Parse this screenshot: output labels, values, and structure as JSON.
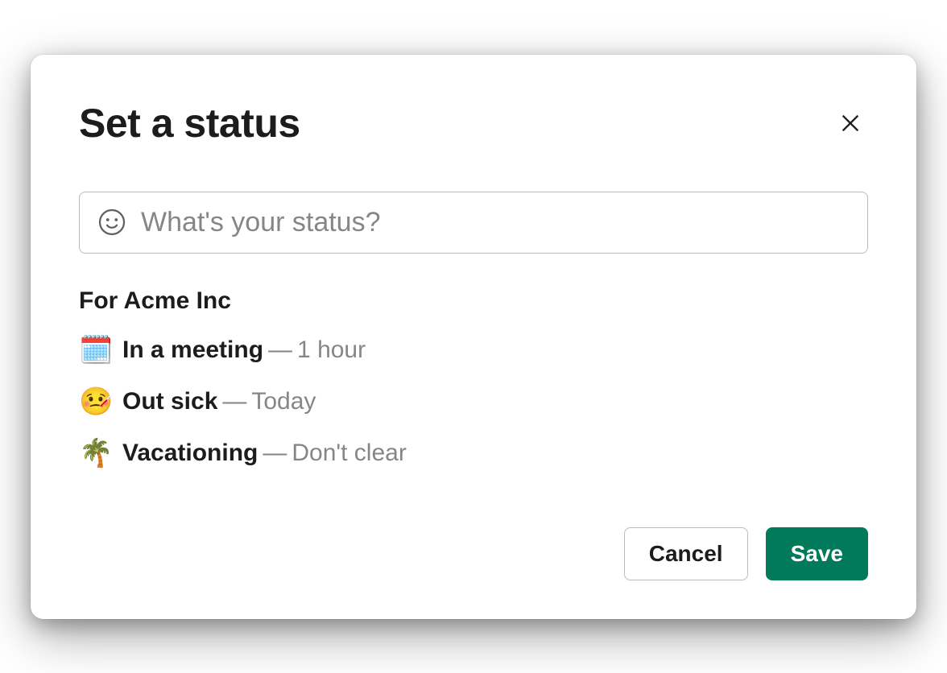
{
  "modal": {
    "title": "Set a status",
    "close_label": "Close"
  },
  "status_input": {
    "placeholder": "What's your status?",
    "value": ""
  },
  "presets": {
    "label": "For Acme Inc",
    "separator": " — ",
    "items": [
      {
        "emoji": "🗓️",
        "text": "In a meeting",
        "duration": "1 hour"
      },
      {
        "emoji": "🤒",
        "text": "Out sick",
        "duration": "Today"
      },
      {
        "emoji": "🌴",
        "text": "Vacationing",
        "duration": "Don't clear"
      }
    ]
  },
  "footer": {
    "cancel_label": "Cancel",
    "save_label": "Save"
  }
}
